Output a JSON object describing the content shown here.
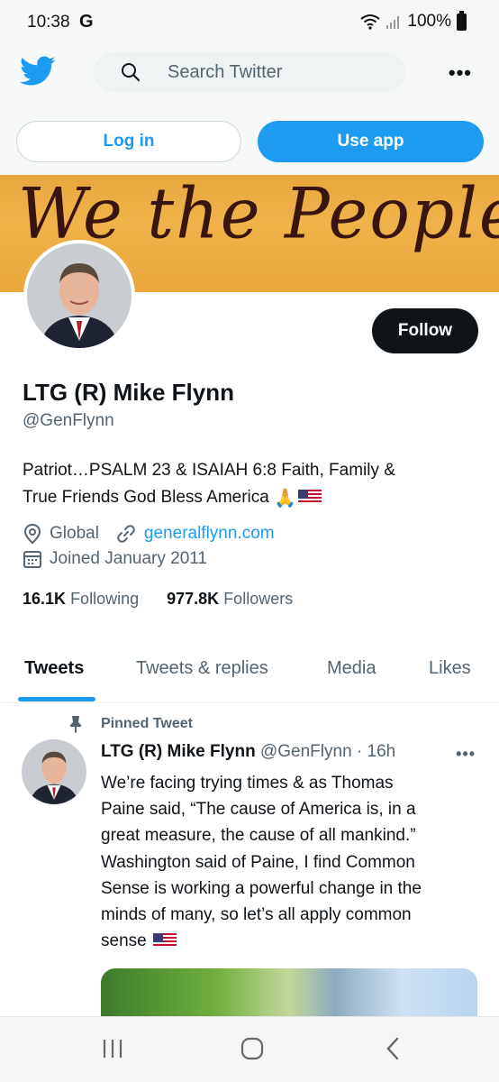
{
  "status_bar": {
    "time": "10:38",
    "carrier_icon": "G",
    "battery": "100%"
  },
  "header": {
    "search_placeholder": "Search Twitter",
    "logo": "twitter-bird-icon",
    "more": "•••"
  },
  "auth": {
    "login_label": "Log in",
    "use_app_label": "Use app"
  },
  "banner": {
    "text": "We the People"
  },
  "profile": {
    "display_name": "LTG (R) Mike Flynn",
    "handle": "@GenFlynn",
    "bio_line1": "Patriot…PSALM 23 & ISAIAH 6:8 Faith, Family &",
    "bio_line2": "True Friends  God Bless America",
    "bio_emoji_hands": "🙏",
    "location": "Global",
    "website": "generalflynn.com",
    "joined": "Joined January 2011",
    "following_count": "16.1K",
    "following_label": "Following",
    "followers_count": "977.8K",
    "followers_label": "Followers",
    "follow_label": "Follow"
  },
  "tabs": [
    {
      "label": "Tweets",
      "active": true
    },
    {
      "label": "Tweets & replies",
      "active": false
    },
    {
      "label": "Media",
      "active": false
    },
    {
      "label": "Likes",
      "active": false
    }
  ],
  "pinned_tweet": {
    "pinned_label": "Pinned Tweet",
    "author_name": "LTG (R) Mike Flynn",
    "author_handle": "@GenFlynn",
    "separator": "·",
    "time": "16h",
    "more": "•••",
    "lines": [
      "We’re facing trying times & as Thomas",
      "Paine said, “The cause of America is, in a",
      "great measure, the cause of all mankind.”",
      "Washington said of Paine, I find Common",
      "Sense is working a powerful change in the",
      "minds of many, so let’s all apply common",
      "sense"
    ]
  },
  "colors": {
    "accent": "#1d9bf0",
    "text": "#0f1419",
    "muted": "#536471",
    "follow_bg": "#0f1419"
  }
}
